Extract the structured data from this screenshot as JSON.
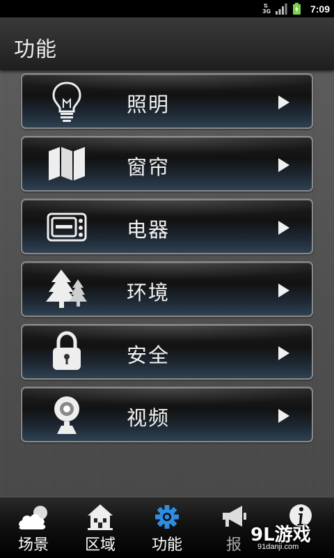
{
  "status_bar": {
    "network": "3G",
    "time": "7:09"
  },
  "title_bar": {
    "title": "功能"
  },
  "menu": {
    "items": [
      {
        "label": "照明",
        "icon": "lightbulb-icon"
      },
      {
        "label": "窗帘",
        "icon": "map-icon"
      },
      {
        "label": "电器",
        "icon": "microwave-icon"
      },
      {
        "label": "环境",
        "icon": "trees-icon"
      },
      {
        "label": "安全",
        "icon": "padlock-icon"
      },
      {
        "label": "视频",
        "icon": "webcam-icon"
      }
    ]
  },
  "tab_bar": {
    "tabs": [
      {
        "label": "场景",
        "icon": "cloud-icon"
      },
      {
        "label": "区域",
        "icon": "house-icon"
      },
      {
        "label": "功能",
        "icon": "gear-icon",
        "active": true
      },
      {
        "label": "报",
        "icon": "megaphone-icon"
      },
      {
        "label": "",
        "icon": "info-icon"
      }
    ]
  },
  "watermark": {
    "main": "9L游戏",
    "sub": "91danji.com"
  },
  "colors": {
    "active_tab_icon": "#2f8de0",
    "menu_border": "#8a8a8a"
  }
}
